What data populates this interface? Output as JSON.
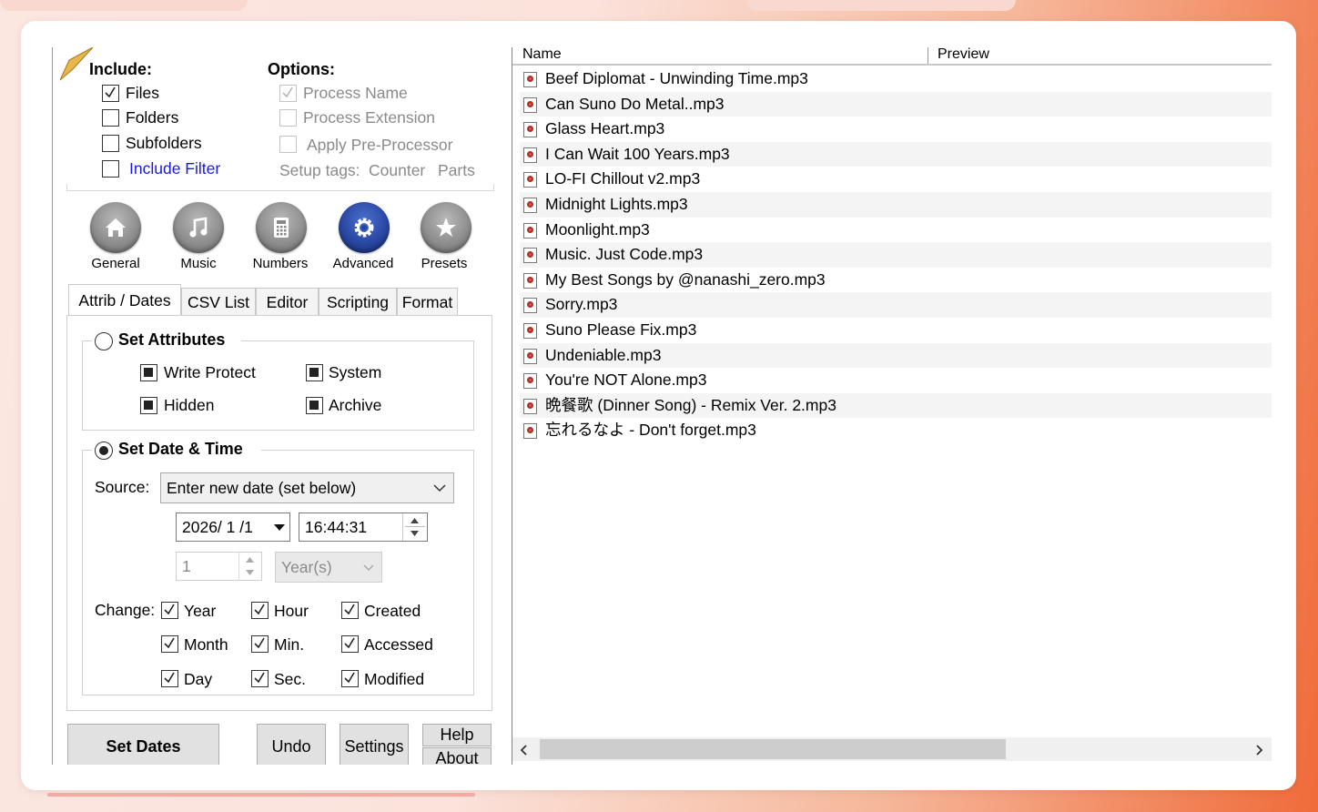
{
  "include": {
    "header": "Include:",
    "files": "Files",
    "folders": "Folders",
    "subfolders": "Subfolders",
    "include_filter": "Include Filter"
  },
  "options": {
    "header": "Options:",
    "process_name": "Process Name",
    "process_extension": "Process Extension",
    "apply_preprocessor": "Apply Pre-Processor",
    "setup_tags": "Setup tags:",
    "counter": "Counter",
    "parts": "Parts"
  },
  "modes": [
    {
      "label": "General",
      "icon": "home-icon"
    },
    {
      "label": "Music",
      "icon": "music-note-icon"
    },
    {
      "label": "Numbers",
      "icon": "calculator-icon"
    },
    {
      "label": "Advanced",
      "icon": "gear-icon",
      "active": true
    },
    {
      "label": "Presets",
      "icon": "star-icon"
    }
  ],
  "tabs": [
    "Attrib / Dates",
    "CSV List",
    "Editor",
    "Scripting",
    "Format"
  ],
  "attributes": {
    "header": "Set Attributes",
    "write_protect": "Write Protect",
    "system": "System",
    "hidden": "Hidden",
    "archive": "Archive"
  },
  "datetime": {
    "header": "Set Date & Time",
    "source_label": "Source:",
    "source_value": "Enter new date (set below)",
    "date_value": "2026/ 1 /1",
    "time_value": "16:44:31",
    "offset_value": "1",
    "offset_unit": "Year(s)",
    "change_label": "Change:",
    "year": "Year",
    "hour": "Hour",
    "created": "Created",
    "month": "Month",
    "min": "Min.",
    "accessed": "Accessed",
    "day": "Day",
    "sec": "Sec.",
    "modified": "Modified"
  },
  "buttons": {
    "set_dates": "Set Dates",
    "undo": "Undo",
    "settings": "Settings",
    "help": "Help",
    "about": "About"
  },
  "filelist": {
    "col_name": "Name",
    "col_preview": "Preview",
    "files": [
      "Beef Diplomat - Unwinding Time.mp3",
      "Can Suno Do Metal..mp3",
      "Glass Heart.mp3",
      "I Can Wait 100 Years.mp3",
      "LO-FI Chillout v2.mp3",
      "Midnight Lights.mp3",
      "Moonlight.mp3",
      "Music. Just Code.mp3",
      "My Best Songs by @nanashi_zero.mp3",
      "Sorry.mp3",
      "Suno Please Fix.mp3",
      "Undeniable.mp3",
      "You're NOT Alone.mp3",
      "晩餐歌 (Dinner Song) - Remix Ver. 2.mp3",
      "忘れるなよ - Don't forget.mp3"
    ]
  }
}
